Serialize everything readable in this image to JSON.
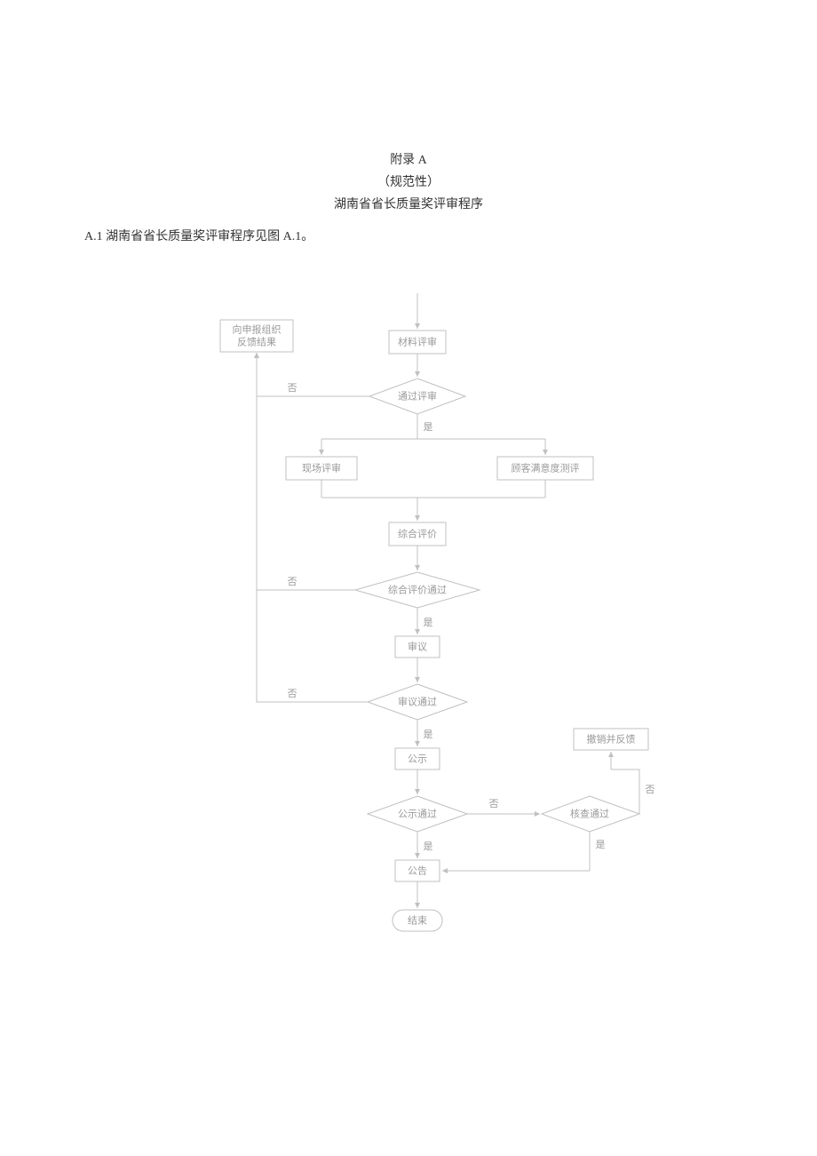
{
  "header": {
    "appendix": "附录 A",
    "normative": "（规范性）",
    "title": "湖南省省长质量奖评审程序"
  },
  "caption": "A.1 湖南省省长质量奖评审程序见图 A.1。",
  "nodes": {
    "feedback": {
      "line1": "向申报组织",
      "line2": "反馈结果"
    },
    "material_review": "材料评审",
    "pass_review": "通过评审",
    "onsite_review": "现场评审",
    "customer_sat": "顾客满意度测评",
    "comprehensive_eval": "综合评价",
    "comprehensive_pass": "综合评价通过",
    "deliberation": "审议",
    "deliberation_pass": "审议通过",
    "publicity": "公示",
    "publicity_pass": "公示通过",
    "announcement": "公告",
    "end": "结束",
    "revoke_feedback": "撤销并反馈",
    "verify_pass": "核查通过"
  },
  "labels": {
    "yes": "是",
    "no": "否"
  },
  "chart_data": {
    "type": "flowchart",
    "title": "湖南省省长质量奖评审程序",
    "nodes": [
      {
        "id": "start_arrow",
        "type": "connector"
      },
      {
        "id": "feedback",
        "type": "process",
        "label": "向申报组织反馈结果"
      },
      {
        "id": "material_review",
        "type": "process",
        "label": "材料评审"
      },
      {
        "id": "pass_review",
        "type": "decision",
        "label": "通过评审"
      },
      {
        "id": "onsite_review",
        "type": "process",
        "label": "现场评审"
      },
      {
        "id": "customer_sat",
        "type": "process",
        "label": "顾客满意度测评"
      },
      {
        "id": "comprehensive_eval",
        "type": "process",
        "label": "综合评价"
      },
      {
        "id": "comprehensive_pass",
        "type": "decision",
        "label": "综合评价通过"
      },
      {
        "id": "deliberation",
        "type": "process",
        "label": "审议"
      },
      {
        "id": "deliberation_pass",
        "type": "decision",
        "label": "审议通过"
      },
      {
        "id": "publicity",
        "type": "process",
        "label": "公示"
      },
      {
        "id": "publicity_pass",
        "type": "decision",
        "label": "公示通过"
      },
      {
        "id": "verify_pass",
        "type": "decision",
        "label": "核查通过"
      },
      {
        "id": "revoke_feedback",
        "type": "process",
        "label": "撤销并反馈"
      },
      {
        "id": "announcement",
        "type": "process",
        "label": "公告"
      },
      {
        "id": "end",
        "type": "terminator",
        "label": "结束"
      }
    ],
    "edges": [
      {
        "from": "start_arrow",
        "to": "material_review"
      },
      {
        "from": "material_review",
        "to": "pass_review"
      },
      {
        "from": "pass_review",
        "to": "onsite_review",
        "label": "是"
      },
      {
        "from": "pass_review",
        "to": "customer_sat",
        "label": "是"
      },
      {
        "from": "pass_review",
        "to": "feedback",
        "label": "否"
      },
      {
        "from": "onsite_review",
        "to": "comprehensive_eval"
      },
      {
        "from": "customer_sat",
        "to": "comprehensive_eval"
      },
      {
        "from": "comprehensive_eval",
        "to": "comprehensive_pass"
      },
      {
        "from": "comprehensive_pass",
        "to": "deliberation",
        "label": "是"
      },
      {
        "from": "comprehensive_pass",
        "to": "feedback",
        "label": "否"
      },
      {
        "from": "deliberation",
        "to": "deliberation_pass"
      },
      {
        "from": "deliberation_pass",
        "to": "publicity",
        "label": "是"
      },
      {
        "from": "deliberation_pass",
        "to": "feedback",
        "label": "否"
      },
      {
        "from": "publicity",
        "to": "publicity_pass"
      },
      {
        "from": "publicity_pass",
        "to": "announcement",
        "label": "是"
      },
      {
        "from": "publicity_pass",
        "to": "verify_pass",
        "label": "否"
      },
      {
        "from": "verify_pass",
        "to": "announcement",
        "label": "是"
      },
      {
        "from": "verify_pass",
        "to": "revoke_feedback",
        "label": "否"
      },
      {
        "from": "announcement",
        "to": "end"
      }
    ]
  }
}
